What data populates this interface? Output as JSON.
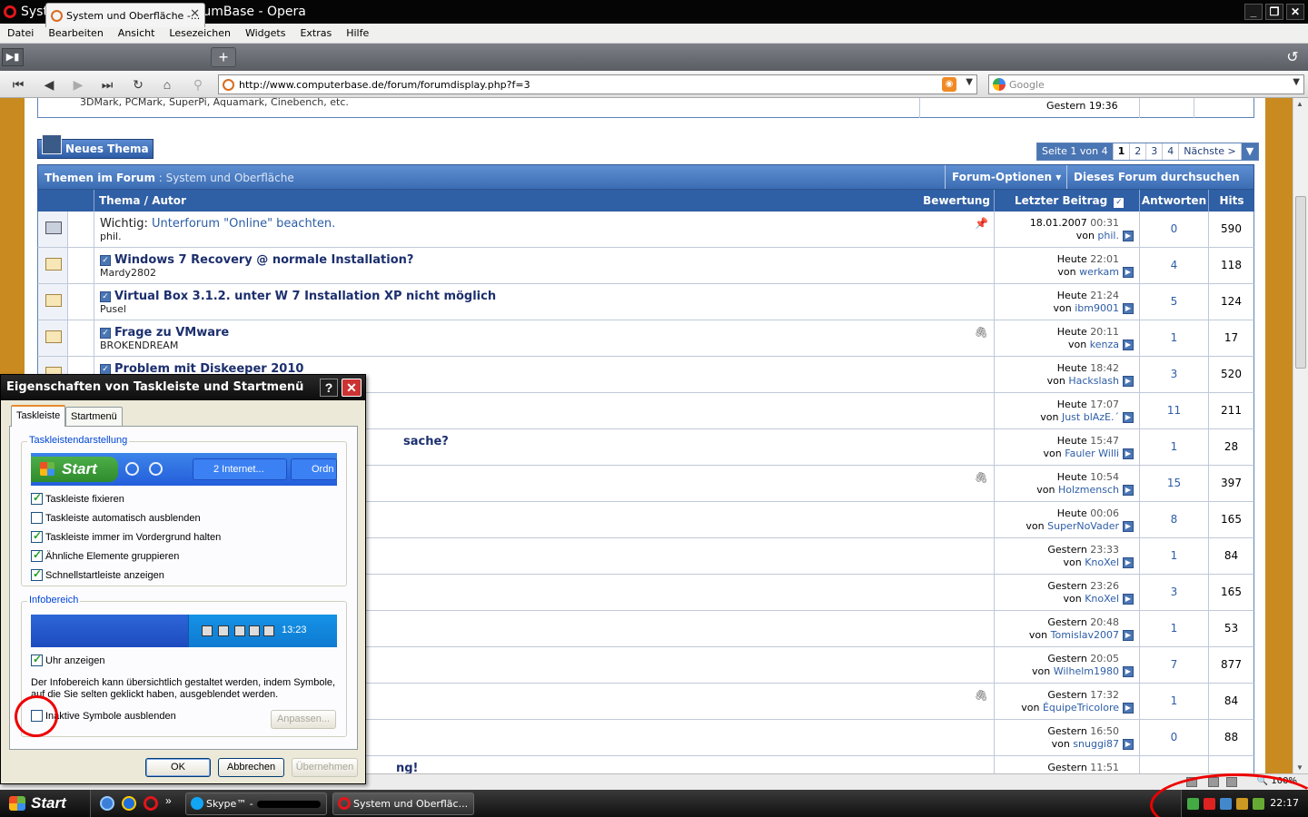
{
  "window": {
    "title": "System und Oberfläche - ForumBase - Opera"
  },
  "menu": [
    "Datei",
    "Bearbeiten",
    "Ansicht",
    "Lesezeichen",
    "Widgets",
    "Extras",
    "Hilfe"
  ],
  "tab": {
    "label": "System und Oberfläche -...",
    "close": "✕"
  },
  "address": {
    "url": "http://www.computerbase.de/forum/forumdisplay.php?f=3",
    "search_placeholder": "Google"
  },
  "forum": {
    "prev_row_text": "3DMark, PCMark, SuperPi, Aquamark, Cinebench, etc.",
    "prev_row_last": "Gestern 19:36",
    "new_thread": "Neues Thema",
    "pager": {
      "label": "Seite 1 von 4",
      "pages": [
        "1",
        "2",
        "3",
        "4"
      ],
      "next": "Nächste >",
      "dd": "▼"
    },
    "head_title": "Themen im Forum",
    "head_sub": " : System und Oberfläche",
    "options": "Forum-Optionen ▾",
    "search": "Dieses Forum durchsuchen ▾",
    "columns": {
      "topic": "Thema / Autor",
      "rating": "Bewertung",
      "last": "Letzter Beitrag",
      "replies": "Antworten",
      "hits": "Hits"
    },
    "threads": [
      {
        "prefix": "Wichtig: ",
        "title": "Unterforum \"Online\" beachten.",
        "author": "phil.",
        "day": "18.01.2007",
        "time": "00:31",
        "by": "phil.",
        "replies": "0",
        "hits": "590",
        "sticky": true,
        "clip": "📌"
      },
      {
        "title": "Windows 7 Recovery @ normale Installation?",
        "author": "Mardy2802",
        "day": "Heute",
        "time": "22:01",
        "by": "werkam",
        "replies": "4",
        "hits": "118"
      },
      {
        "title": "Virtual Box 3.1.2. unter W 7 Installation XP nicht möglich",
        "author": "Pusel",
        "day": "Heute",
        "time": "21:24",
        "by": "ibm9001",
        "replies": "5",
        "hits": "124"
      },
      {
        "title": "Frage zu VMware",
        "author": "BROKENDREAM",
        "day": "Heute",
        "time": "20:11",
        "by": "kenza",
        "replies": "1",
        "hits": "17",
        "clip": "🖇"
      },
      {
        "title": "Problem mit Diskeeper 2010",
        "author": "",
        "day": "Heute",
        "time": "18:42",
        "by": "Hackslash",
        "replies": "3",
        "hits": "520"
      },
      {
        "title": "",
        "author": "",
        "day": "Heute",
        "time": "17:07",
        "by": "Just blAzE.´",
        "replies": "11",
        "hits": "211"
      },
      {
        "title": "sache?",
        "author": "",
        "day": "Heute",
        "time": "15:47",
        "by": "Fauler Willi",
        "replies": "1",
        "hits": "28"
      },
      {
        "title": "",
        "author": "",
        "day": "Heute",
        "time": "10:54",
        "by": "Holzmensch",
        "replies": "15",
        "hits": "397",
        "clip": "🖇"
      },
      {
        "title": "",
        "author": "",
        "day": "Heute",
        "time": "00:06",
        "by": "SuperNoVader",
        "replies": "8",
        "hits": "165"
      },
      {
        "title": "",
        "author": "",
        "day": "Gestern",
        "time": "23:33",
        "by": "KnoXel",
        "replies": "1",
        "hits": "84"
      },
      {
        "title": "",
        "author": "",
        "day": "Gestern",
        "time": "23:26",
        "by": "KnoXel",
        "replies": "3",
        "hits": "165"
      },
      {
        "title": "",
        "author": "",
        "day": "Gestern",
        "time": "20:48",
        "by": "Tomislav2007",
        "replies": "1",
        "hits": "53"
      },
      {
        "title": "",
        "author": "",
        "day": "Gestern",
        "time": "20:05",
        "by": "Wilhelm1980",
        "replies": "7",
        "hits": "877"
      },
      {
        "title": "",
        "author": "",
        "day": "Gestern",
        "time": "17:32",
        "by": "ÉquipeTricolore",
        "replies": "1",
        "hits": "84",
        "clip": "🖇"
      },
      {
        "title": "",
        "author": "",
        "day": "Gestern",
        "time": "16:50",
        "by": "snuggi87",
        "replies": "0",
        "hits": "88"
      },
      {
        "title": "ng!",
        "author": "",
        "day": "Gestern",
        "time": "11:51",
        "by": "",
        "replies": "",
        "hits": ""
      }
    ],
    "von": "von"
  },
  "status": {
    "zoom": "100%"
  },
  "taskbar": {
    "start": "Start",
    "skype": "Skype™ -",
    "opera": "System und Oberfläc...",
    "clock": "22:17",
    "chev": "»"
  },
  "dialog": {
    "title": "Eigenschaften von Taskleiste und Startmenü",
    "help": "?",
    "close": "✕",
    "tabs": [
      "Taskleiste",
      "Startmenü"
    ],
    "group1": "Taskleistendarstellung",
    "preview": {
      "start": "Start",
      "btn1": "2 Internet...",
      "btn2": "Ordn"
    },
    "checks1": [
      {
        "label": "Taskleiste fixieren",
        "checked": true
      },
      {
        "label": "Taskleiste automatisch ausblenden",
        "checked": false
      },
      {
        "label": "Taskleiste immer im Vordergrund halten",
        "checked": true
      },
      {
        "label": "Ähnliche Elemente gruppieren",
        "checked": true
      },
      {
        "label": "Schnellstartleiste anzeigen",
        "checked": true
      }
    ],
    "group2": "Infobereich",
    "tray_clock": "13:23",
    "clock_check": "Uhr anzeigen",
    "info": "Der Infobereich kann übersichtlich gestaltet werden, indem Symbole, auf die Sie selten geklickt haben, ausgeblendet werden.",
    "inactive": "Inaktive Symbole ausblenden",
    "customize": "Anpassen...",
    "ok": "OK",
    "cancel": "Abbrechen",
    "apply": "Übernehmen"
  },
  "colors": {
    "forum_blue": "#2f5fa4",
    "link": "#2d5da6",
    "side": "#c98a20",
    "annotation": "#e00000"
  }
}
